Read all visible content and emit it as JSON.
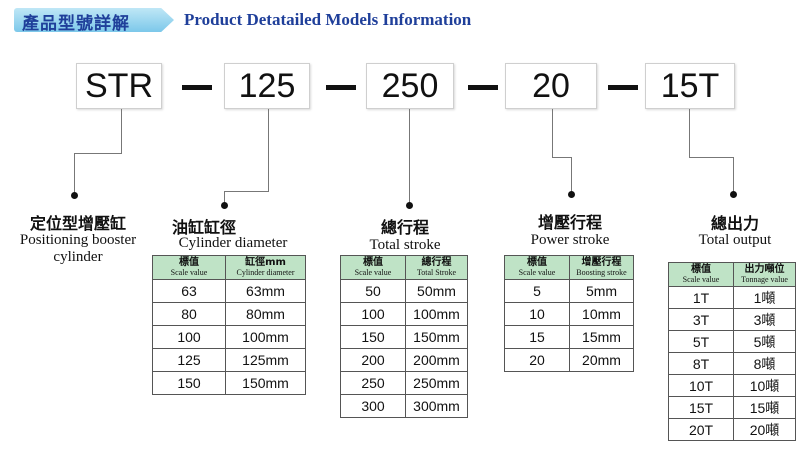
{
  "header": {
    "zh_title": "產品型號詳解",
    "en_title": "Product Detatailed Models Information"
  },
  "model_code": [
    "STR",
    "125",
    "250",
    "20",
    "15T"
  ],
  "sections": {
    "type": {
      "zh": "定位型增壓缸",
      "en_line1": "Positioning booster",
      "en_line2": "cylinder"
    },
    "diameter": {
      "zh": "油缸缸徑",
      "en": "Cylinder diameter"
    },
    "stroke": {
      "zh": "總行程",
      "en": "Total stroke"
    },
    "power": {
      "zh": "增壓行程",
      "en": "Power stroke"
    },
    "output": {
      "zh": "總出力",
      "en": "Total output"
    }
  },
  "tables": {
    "diameter": {
      "headers": [
        {
          "zh": "標值",
          "en": "Scale value"
        },
        {
          "zh": "缸徑mm",
          "en": "Cylinder diameter"
        }
      ],
      "rows": [
        [
          "63",
          "63mm"
        ],
        [
          "80",
          "80mm"
        ],
        [
          "100",
          "100mm"
        ],
        [
          "125",
          "125mm"
        ],
        [
          "150",
          "150mm"
        ]
      ]
    },
    "stroke": {
      "headers": [
        {
          "zh": "標值",
          "en": "Scale value"
        },
        {
          "zh": "總行程",
          "en": "Total Stroke"
        }
      ],
      "rows": [
        [
          "50",
          "50mm"
        ],
        [
          "100",
          "100mm"
        ],
        [
          "150",
          "150mm"
        ],
        [
          "200",
          "200mm"
        ],
        [
          "250",
          "250mm"
        ],
        [
          "300",
          "300mm"
        ]
      ]
    },
    "power": {
      "headers": [
        {
          "zh": "標值",
          "en": "Scale value"
        },
        {
          "zh": "增壓行程",
          "en": "Boosting stroke"
        }
      ],
      "rows": [
        [
          "5",
          "5mm"
        ],
        [
          "10",
          "10mm"
        ],
        [
          "15",
          "15mm"
        ],
        [
          "20",
          "20mm"
        ]
      ]
    },
    "output": {
      "headers": [
        {
          "zh": "標值",
          "en": "Scale value"
        },
        {
          "zh": "出力噸位",
          "en": "Tonnage value"
        }
      ],
      "rows": [
        [
          "1T",
          "1噸"
        ],
        [
          "3T",
          "3噸"
        ],
        [
          "5T",
          "5噸"
        ],
        [
          "8T",
          "8噸"
        ],
        [
          "10T",
          "10噸"
        ],
        [
          "15T",
          "15噸"
        ],
        [
          "20T",
          "20噸"
        ]
      ]
    }
  },
  "colors": {
    "header_blue": "#1f3f9a",
    "table_header_green": "#bfe3c6",
    "tab_blue": "#7cc8ea"
  }
}
